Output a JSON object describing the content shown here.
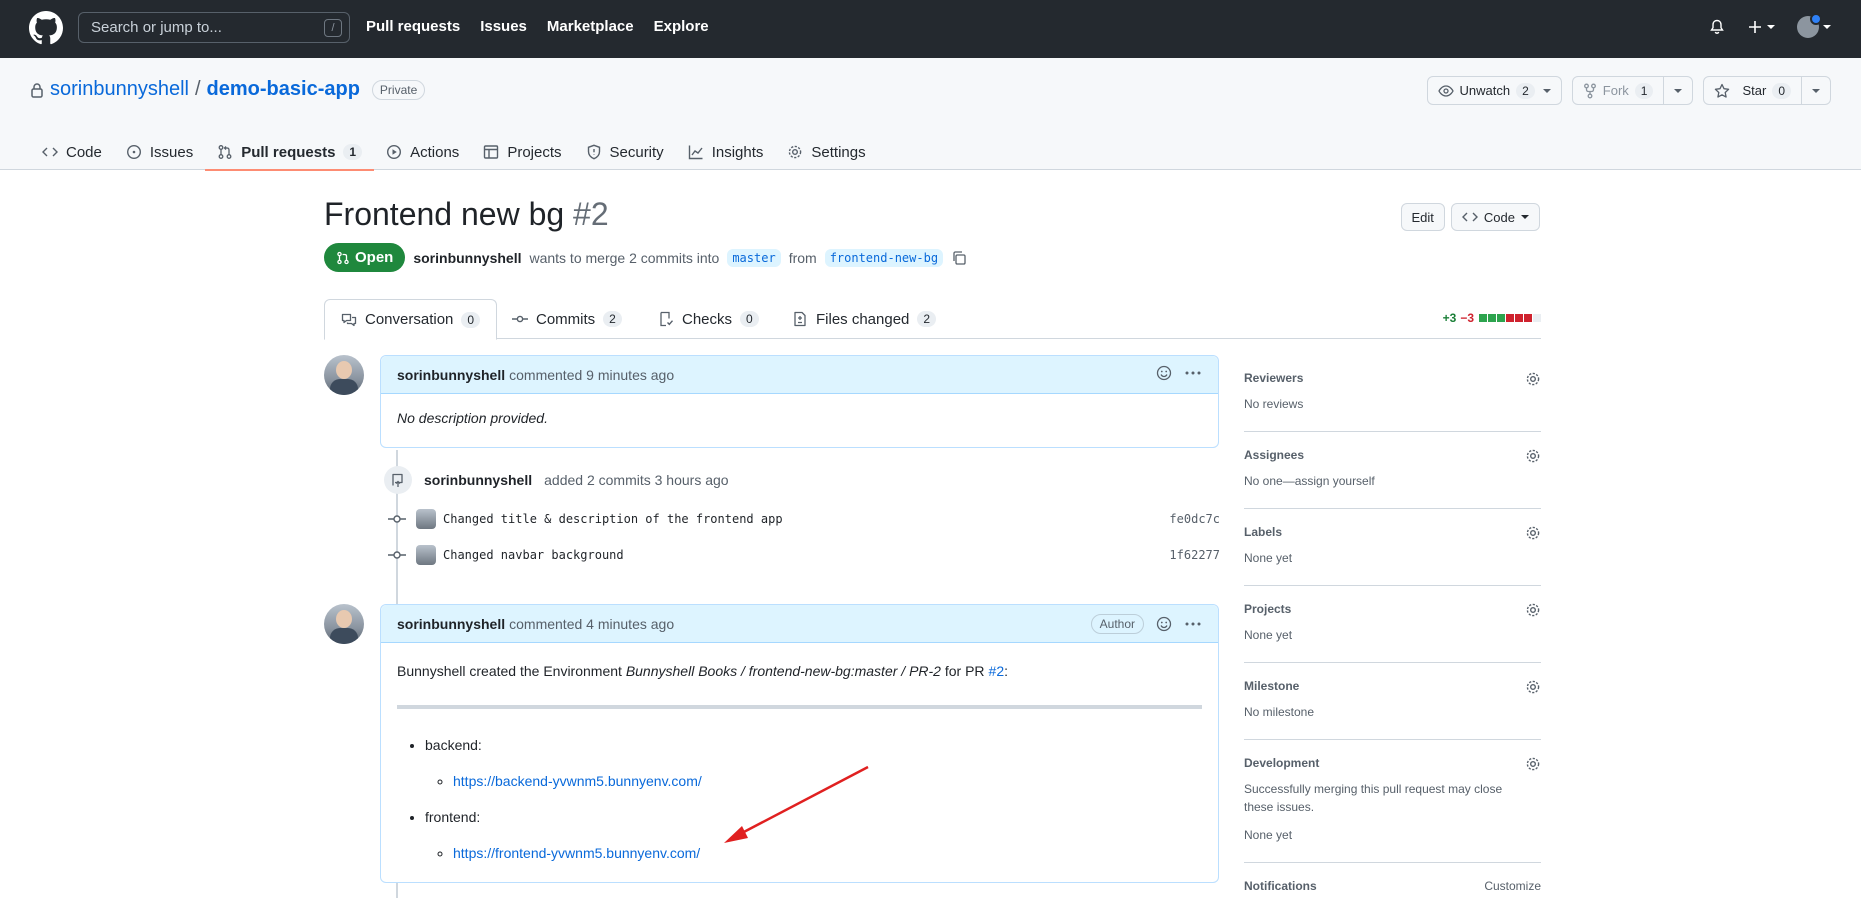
{
  "header": {
    "search_placeholder": "Search or jump to...",
    "search_shortcut": "/",
    "nav": [
      "Pull requests",
      "Issues",
      "Marketplace",
      "Explore"
    ]
  },
  "repo": {
    "owner": "sorinbunnyshell",
    "separator": "/",
    "name": "demo-basic-app",
    "visibility": "Private",
    "watch_label": "Unwatch",
    "watch_count": "2",
    "fork_label": "Fork",
    "fork_count": "1",
    "star_label": "Star",
    "star_count": "0",
    "tabs": [
      {
        "label": "Code"
      },
      {
        "label": "Issues"
      },
      {
        "label": "Pull requests",
        "count": "1"
      },
      {
        "label": "Actions"
      },
      {
        "label": "Projects"
      },
      {
        "label": "Security"
      },
      {
        "label": "Insights"
      },
      {
        "label": "Settings"
      }
    ]
  },
  "pr": {
    "title": "Frontend new bg",
    "number": "#2",
    "edit_label": "Edit",
    "code_label": "Code",
    "state": "Open",
    "author": "sorinbunnyshell",
    "merge_text": "wants to merge 2 commits into",
    "base_branch": "master",
    "from_text": "from",
    "head_branch": "frontend-new-bg",
    "tabs": [
      {
        "label": "Conversation",
        "count": "0"
      },
      {
        "label": "Commits",
        "count": "2"
      },
      {
        "label": "Checks",
        "count": "0"
      },
      {
        "label": "Files changed",
        "count": "2"
      }
    ],
    "additions": "+3",
    "deletions": "−3"
  },
  "timeline": {
    "comment1": {
      "author": "sorinbunnyshell",
      "action": "commented 9 minutes ago",
      "body": "No description provided."
    },
    "commits_event": {
      "author": "sorinbunnyshell",
      "text": "added 2 commits 3 hours ago",
      "commits": [
        {
          "message": "Changed title & description of the frontend app",
          "sha": "fe0dc7c"
        },
        {
          "message": "Changed navbar background",
          "sha": "1f62277"
        }
      ]
    },
    "comment2": {
      "author": "sorinbunnyshell",
      "action": "commented 4 minutes ago",
      "badge": "Author",
      "intro": "Bunnyshell created the Environment",
      "env_name": "Bunnyshell Books / frontend-new-bg:master / PR-2",
      "for_pr": "for PR",
      "pr_link": "#2",
      "colon": ":",
      "backend_label": "backend:",
      "backend_url": "https://backend-yvwnm5.bunnyenv.com/",
      "frontend_label": "frontend:",
      "frontend_url": "https://frontend-yvwnm5.bunnyenv.com/"
    }
  },
  "sidebar": {
    "reviewers": {
      "title": "Reviewers",
      "value": "No reviews"
    },
    "assignees": {
      "title": "Assignees",
      "value": "No one—assign yourself"
    },
    "labels": {
      "title": "Labels",
      "value": "None yet"
    },
    "projects": {
      "title": "Projects",
      "value": "None yet"
    },
    "milestone": {
      "title": "Milestone",
      "value": "No milestone"
    },
    "development": {
      "title": "Development",
      "value": "Successfully merging this pull request may close these issues.",
      "value2": "None yet"
    },
    "notifications": {
      "title": "Notifications",
      "action": "Customize"
    }
  },
  "colors": {
    "header_bg": "#24292f",
    "open_green": "#1f883d",
    "link_blue": "#0969da",
    "comment_head_bg": "#ddf4ff",
    "annotation_red": "#e02020"
  }
}
